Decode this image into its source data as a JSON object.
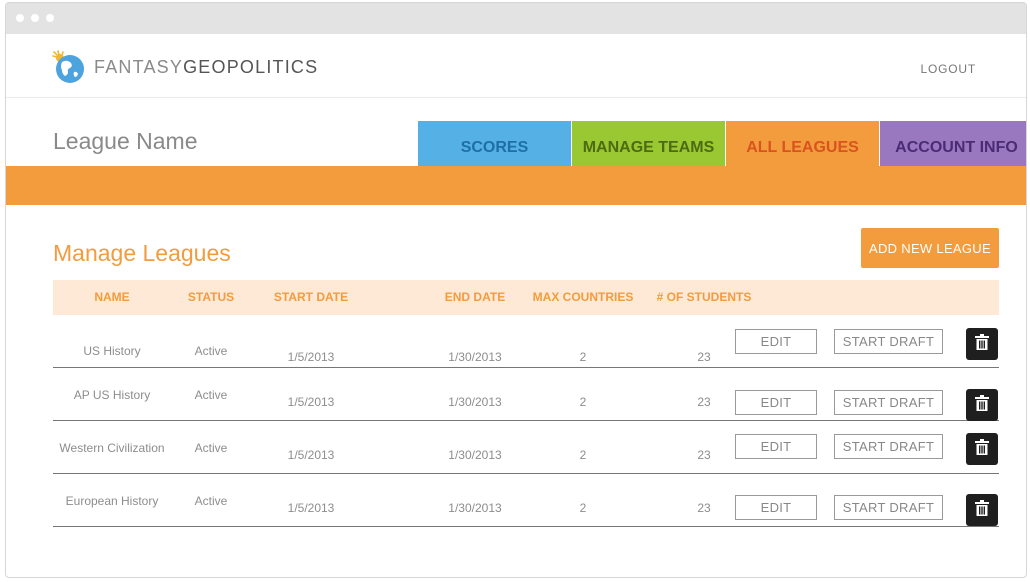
{
  "header": {
    "brand_part1": "FANTASY",
    "brand_part2": "GEOPOLITICS",
    "logout_label": "LOGOUT"
  },
  "league": {
    "name": "League Name"
  },
  "tabs": [
    {
      "label": "SCORES",
      "bg": "#55b0e6",
      "color": "#1e6fa6"
    },
    {
      "label": "MANAGE TEAMS",
      "bg": "#9ac832",
      "color": "#4d6b12"
    },
    {
      "label": "ALL LEAGUES",
      "bg": "#f39c3d",
      "color": "#d9531e",
      "active": true
    },
    {
      "label": "ACCOUNT INFO",
      "bg": "#9a78c0",
      "color": "#4a2c74"
    }
  ],
  "colors": {
    "accent": "#f39c3d",
    "header_bg": "#fde9d6",
    "trash_bg": "#1f1f1f"
  },
  "manage": {
    "title": "Manage Leagues",
    "add_label": "ADD NEW LEAGUE",
    "columns": [
      "NAME",
      "STATUS",
      "START DATE",
      "END DATE",
      "MAX COUNTRIES",
      "# OF STUDENTS"
    ],
    "edit_label": "EDIT",
    "draft_label": "START DRAFT",
    "trash_icon": "trash-icon",
    "rows": [
      {
        "name": "US History",
        "status": "Active",
        "start": "1/5/2013",
        "end": "1/30/2013",
        "max": "2",
        "students": "23"
      },
      {
        "name": "AP US History",
        "status": "Active",
        "start": "1/5/2013",
        "end": "1/30/2013",
        "max": "2",
        "students": "23"
      },
      {
        "name": "Western Civilization",
        "status": "Active",
        "start": "1/5/2013",
        "end": "1/30/2013",
        "max": "2",
        "students": "23"
      },
      {
        "name": "European History",
        "status": "Active",
        "start": "1/5/2013",
        "end": "1/30/2013",
        "max": "2",
        "students": "23"
      }
    ]
  }
}
